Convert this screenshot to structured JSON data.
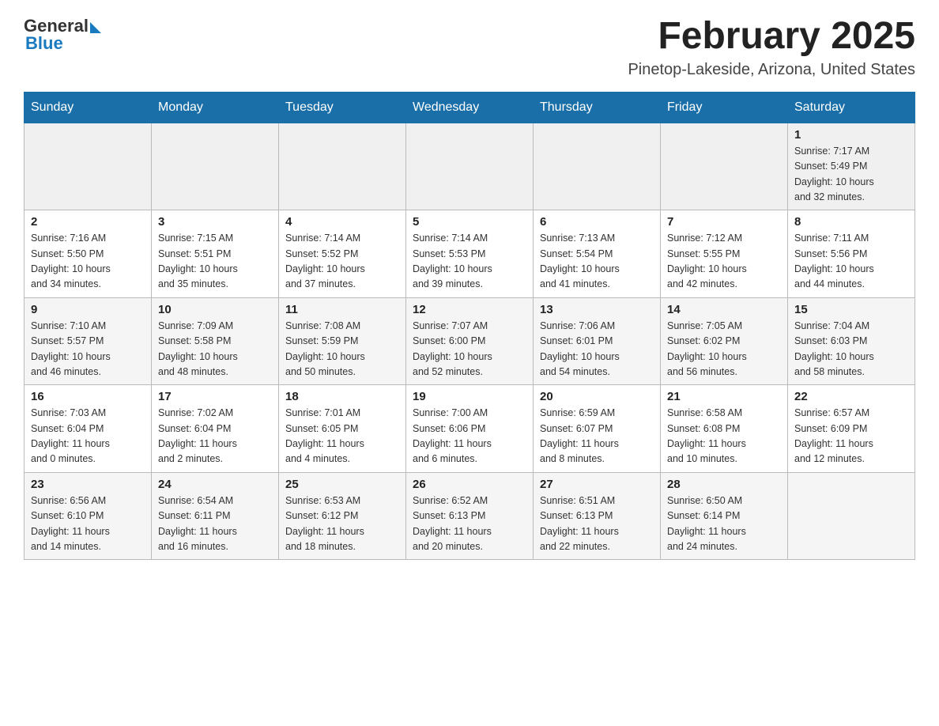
{
  "header": {
    "logo": {
      "general": "General",
      "blue": "Blue"
    },
    "title": "February 2025",
    "location": "Pinetop-Lakeside, Arizona, United States"
  },
  "days_of_week": [
    "Sunday",
    "Monday",
    "Tuesday",
    "Wednesday",
    "Thursday",
    "Friday",
    "Saturday"
  ],
  "weeks": [
    {
      "days": [
        {
          "num": "",
          "info": ""
        },
        {
          "num": "",
          "info": ""
        },
        {
          "num": "",
          "info": ""
        },
        {
          "num": "",
          "info": ""
        },
        {
          "num": "",
          "info": ""
        },
        {
          "num": "",
          "info": ""
        },
        {
          "num": "1",
          "info": "Sunrise: 7:17 AM\nSunset: 5:49 PM\nDaylight: 10 hours\nand 32 minutes."
        }
      ]
    },
    {
      "days": [
        {
          "num": "2",
          "info": "Sunrise: 7:16 AM\nSunset: 5:50 PM\nDaylight: 10 hours\nand 34 minutes."
        },
        {
          "num": "3",
          "info": "Sunrise: 7:15 AM\nSunset: 5:51 PM\nDaylight: 10 hours\nand 35 minutes."
        },
        {
          "num": "4",
          "info": "Sunrise: 7:14 AM\nSunset: 5:52 PM\nDaylight: 10 hours\nand 37 minutes."
        },
        {
          "num": "5",
          "info": "Sunrise: 7:14 AM\nSunset: 5:53 PM\nDaylight: 10 hours\nand 39 minutes."
        },
        {
          "num": "6",
          "info": "Sunrise: 7:13 AM\nSunset: 5:54 PM\nDaylight: 10 hours\nand 41 minutes."
        },
        {
          "num": "7",
          "info": "Sunrise: 7:12 AM\nSunset: 5:55 PM\nDaylight: 10 hours\nand 42 minutes."
        },
        {
          "num": "8",
          "info": "Sunrise: 7:11 AM\nSunset: 5:56 PM\nDaylight: 10 hours\nand 44 minutes."
        }
      ]
    },
    {
      "days": [
        {
          "num": "9",
          "info": "Sunrise: 7:10 AM\nSunset: 5:57 PM\nDaylight: 10 hours\nand 46 minutes."
        },
        {
          "num": "10",
          "info": "Sunrise: 7:09 AM\nSunset: 5:58 PM\nDaylight: 10 hours\nand 48 minutes."
        },
        {
          "num": "11",
          "info": "Sunrise: 7:08 AM\nSunset: 5:59 PM\nDaylight: 10 hours\nand 50 minutes."
        },
        {
          "num": "12",
          "info": "Sunrise: 7:07 AM\nSunset: 6:00 PM\nDaylight: 10 hours\nand 52 minutes."
        },
        {
          "num": "13",
          "info": "Sunrise: 7:06 AM\nSunset: 6:01 PM\nDaylight: 10 hours\nand 54 minutes."
        },
        {
          "num": "14",
          "info": "Sunrise: 7:05 AM\nSunset: 6:02 PM\nDaylight: 10 hours\nand 56 minutes."
        },
        {
          "num": "15",
          "info": "Sunrise: 7:04 AM\nSunset: 6:03 PM\nDaylight: 10 hours\nand 58 minutes."
        }
      ]
    },
    {
      "days": [
        {
          "num": "16",
          "info": "Sunrise: 7:03 AM\nSunset: 6:04 PM\nDaylight: 11 hours\nand 0 minutes."
        },
        {
          "num": "17",
          "info": "Sunrise: 7:02 AM\nSunset: 6:04 PM\nDaylight: 11 hours\nand 2 minutes."
        },
        {
          "num": "18",
          "info": "Sunrise: 7:01 AM\nSunset: 6:05 PM\nDaylight: 11 hours\nand 4 minutes."
        },
        {
          "num": "19",
          "info": "Sunrise: 7:00 AM\nSunset: 6:06 PM\nDaylight: 11 hours\nand 6 minutes."
        },
        {
          "num": "20",
          "info": "Sunrise: 6:59 AM\nSunset: 6:07 PM\nDaylight: 11 hours\nand 8 minutes."
        },
        {
          "num": "21",
          "info": "Sunrise: 6:58 AM\nSunset: 6:08 PM\nDaylight: 11 hours\nand 10 minutes."
        },
        {
          "num": "22",
          "info": "Sunrise: 6:57 AM\nSunset: 6:09 PM\nDaylight: 11 hours\nand 12 minutes."
        }
      ]
    },
    {
      "days": [
        {
          "num": "23",
          "info": "Sunrise: 6:56 AM\nSunset: 6:10 PM\nDaylight: 11 hours\nand 14 minutes."
        },
        {
          "num": "24",
          "info": "Sunrise: 6:54 AM\nSunset: 6:11 PM\nDaylight: 11 hours\nand 16 minutes."
        },
        {
          "num": "25",
          "info": "Sunrise: 6:53 AM\nSunset: 6:12 PM\nDaylight: 11 hours\nand 18 minutes."
        },
        {
          "num": "26",
          "info": "Sunrise: 6:52 AM\nSunset: 6:13 PM\nDaylight: 11 hours\nand 20 minutes."
        },
        {
          "num": "27",
          "info": "Sunrise: 6:51 AM\nSunset: 6:13 PM\nDaylight: 11 hours\nand 22 minutes."
        },
        {
          "num": "28",
          "info": "Sunrise: 6:50 AM\nSunset: 6:14 PM\nDaylight: 11 hours\nand 24 minutes."
        },
        {
          "num": "",
          "info": ""
        }
      ]
    }
  ]
}
